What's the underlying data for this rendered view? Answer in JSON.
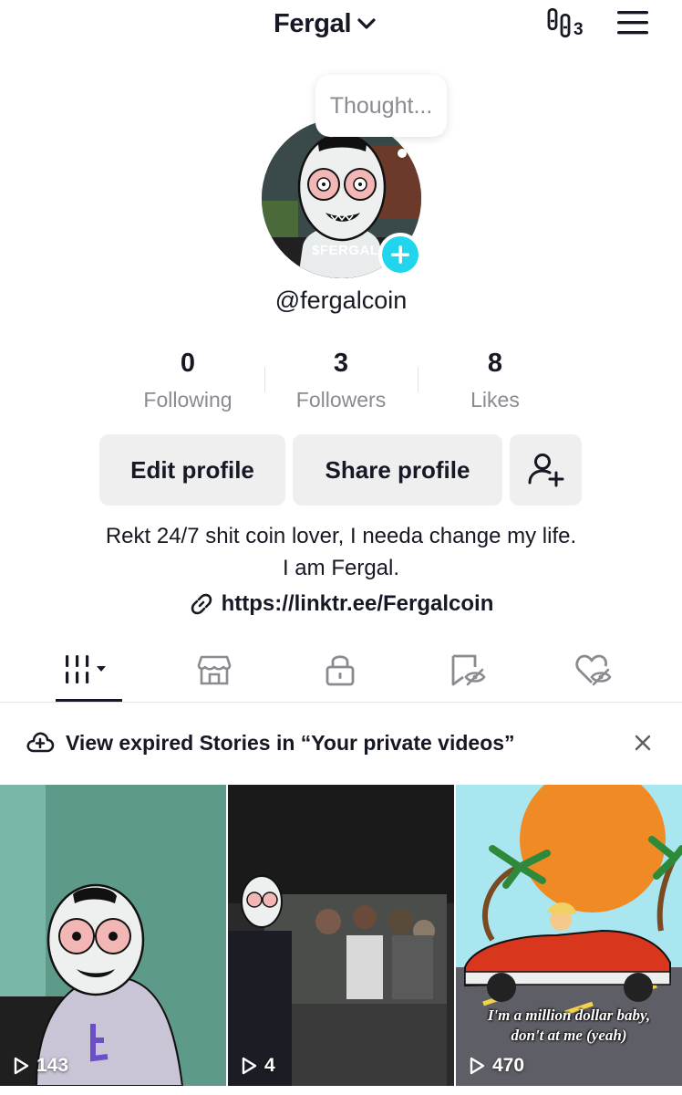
{
  "header": {
    "account_name": "Fergal",
    "footprint_count": "3",
    "icons": {
      "dropdown": "chevron-down-icon",
      "footprint": "footprint-icon",
      "menu": "hamburger-menu-icon"
    }
  },
  "profile": {
    "thought_bubble": "Thought...",
    "avatar_label": "$FERGAL",
    "username": "@fergalcoin",
    "stats": [
      {
        "value": "0",
        "label": "Following"
      },
      {
        "value": "3",
        "label": "Followers"
      },
      {
        "value": "8",
        "label": "Likes"
      }
    ],
    "buttons": {
      "edit": "Edit profile",
      "share": "Share profile"
    },
    "bio_line1": "Rekt 24/7 shit coin lover, I needa change my life.",
    "bio_line2": "I am Fergal.",
    "link": "https://linktr.ee/Fergalcoin"
  },
  "tabs": [
    {
      "icon": "videos-grid-icon",
      "active": true
    },
    {
      "icon": "shop-icon",
      "active": false
    },
    {
      "icon": "lock-icon",
      "active": false
    },
    {
      "icon": "saved-hidden-icon",
      "active": false
    },
    {
      "icon": "liked-hidden-icon",
      "active": false
    }
  ],
  "banner": {
    "text": "View expired Stories in “Your private videos”"
  },
  "videos": [
    {
      "views": "143"
    },
    {
      "views": "4"
    },
    {
      "views": "470",
      "caption_line1": "I'm a million dollar baby,",
      "caption_line2": "don't at me (yeah)"
    }
  ],
  "colors": {
    "accent": "#20d5ec",
    "text": "#161823",
    "muted": "#8a8b91",
    "button_bg": "#efeff0"
  }
}
